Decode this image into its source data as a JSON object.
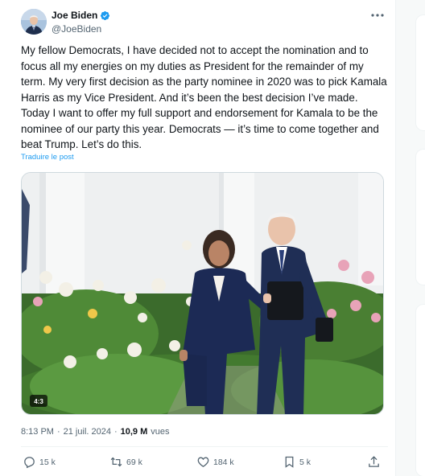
{
  "author": {
    "display_name": "Joe Biden",
    "handle": "@JoeBiden",
    "avatar_icon": "user-avatar-photo",
    "verified_icon": "verified-badge-icon",
    "verified_color": "#1d9bf0"
  },
  "tweet": {
    "text": "My fellow Democrats, I have decided not to accept the nomination and to focus all my energies on my duties as President for the remainder of my term. My very first decision as the party nominee in 2020 was to pick Kamala Harris as my Vice President. And it’s been the best decision I’ve made. Today I want to offer my full support and endorsement for Kamala to be the nominee of our party this year. Democrats — it’s time to come together and beat Trump. Let’s do this.",
    "translate_label": "Traduire le post",
    "media_badge": "4:3"
  },
  "meta": {
    "time": "8:13 PM",
    "separator": "·",
    "date": "21 juil. 2024",
    "views_count": "10,9 M",
    "views_label": "vues"
  },
  "actions": {
    "replies": "15 k",
    "reposts": "69 k",
    "likes": "184 k",
    "bookmarks": "5 k"
  },
  "colors": {
    "link": "#1d9bf0",
    "secondary_text": "#536471",
    "primary_text": "#0f1419"
  }
}
